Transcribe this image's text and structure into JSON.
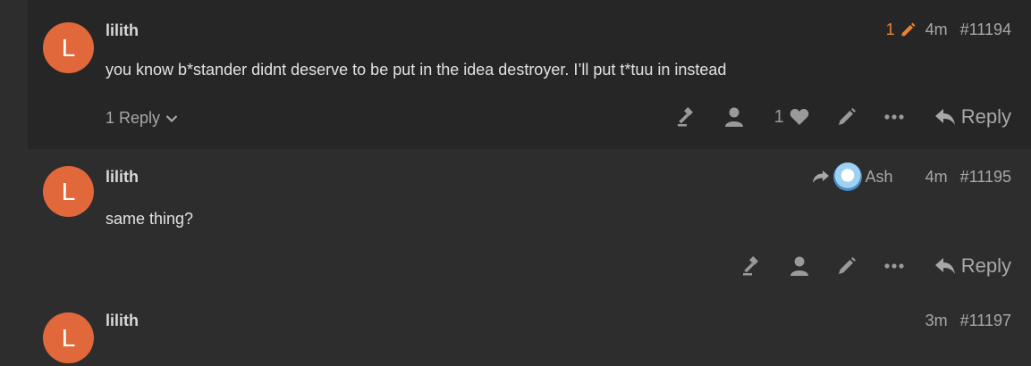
{
  "posts": [
    {
      "avatar_letter": "L",
      "username": "lilith",
      "edit_count": "1",
      "age": "4m",
      "number": "#11194",
      "body": "you know b*stander didnt deserve to be put in the idea destroyer. I’ll put t*tuu in instead",
      "replies_label": "1 Reply",
      "like_count": "1",
      "reply_label": "Reply"
    },
    {
      "avatar_letter": "L",
      "username": "lilith",
      "reply_to_user": "Ash",
      "age": "4m",
      "number": "#11195",
      "body": "same thing?",
      "reply_label": "Reply"
    },
    {
      "avatar_letter": "L",
      "username": "lilith",
      "age": "3m",
      "number": "#11197"
    }
  ],
  "colors": {
    "avatar": "#e0683a",
    "edit_accent": "#f0822d",
    "background": "#2d2d2d",
    "highlight_post": "#262626"
  },
  "icons": [
    "gavel-icon",
    "user-icon",
    "heart-icon",
    "pencil-icon",
    "ellipsis-icon",
    "reply-icon",
    "chevron-down-icon",
    "share-arrow-icon"
  ]
}
